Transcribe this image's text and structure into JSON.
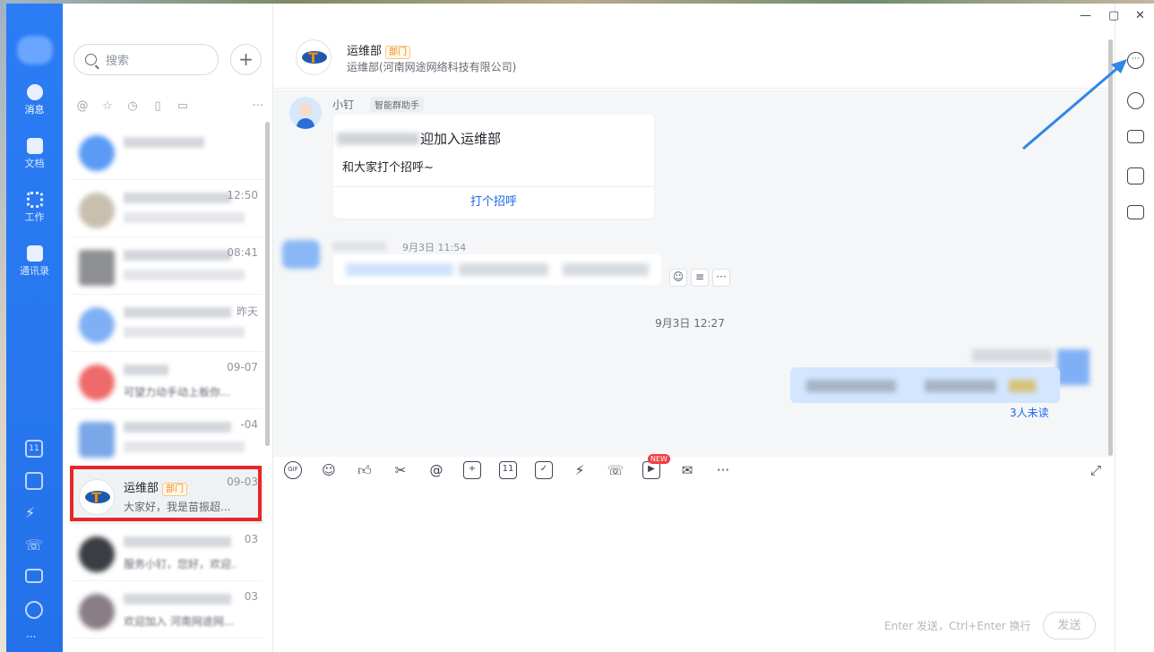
{
  "window": {
    "minimize": "—",
    "maximize": "▢",
    "close": "✕"
  },
  "nav": {
    "items": [
      {
        "label": "消息",
        "icon": "chat-bubble-icon"
      },
      {
        "label": "文档",
        "icon": "document-folder-icon"
      },
      {
        "label": "工作",
        "icon": "apps-grid-icon"
      },
      {
        "label": "通讯录",
        "icon": "contacts-book-icon"
      }
    ],
    "calendar_day": "11",
    "more": "···"
  },
  "list": {
    "search_placeholder": "搜索",
    "add": "+",
    "filter_more": "···",
    "items": [
      {
        "time": ""
      },
      {
        "time": "12:50"
      },
      {
        "time": "08:41"
      },
      {
        "time": "昨天"
      },
      {
        "time": "09-07",
        "preview": "可望力动手动上板你..."
      },
      {
        "time": "-04"
      },
      {
        "name": "运维部",
        "tag": "部门",
        "time": "09-03",
        "preview": "大家好，我是苗振超..."
      },
      {
        "time": "03",
        "preview": "服务小钉，您好，欢迎..."
      },
      {
        "time": "03",
        "preview": "欢迎加入 河南网途网..."
      }
    ]
  },
  "chat": {
    "title": "运维部",
    "title_tag": "部门",
    "subtitle": "运维部(河南网途网络科技有限公司)",
    "bot": {
      "name": "小钉",
      "tag": "智能群助手"
    },
    "card": {
      "title": "迎加入运维部",
      "body": "和大家打个招呼~",
      "button": "打个招呼"
    },
    "msg2_time": "9月3日 11:54",
    "system_date": "9月3日 12:27",
    "unread": "3人未读",
    "input_hint": "Enter 发送，Ctrl+Enter 换行",
    "send_label": "发送",
    "toolbar": {
      "gif": "GIF",
      "calendar": "11",
      "new_badge": "NEW",
      "more": "···"
    }
  },
  "colors": {
    "nav_blue": "#2472ea",
    "link_blue": "#1a6ae8",
    "highlight_red": "#e8262a",
    "tag_orange": "#f08a16"
  }
}
